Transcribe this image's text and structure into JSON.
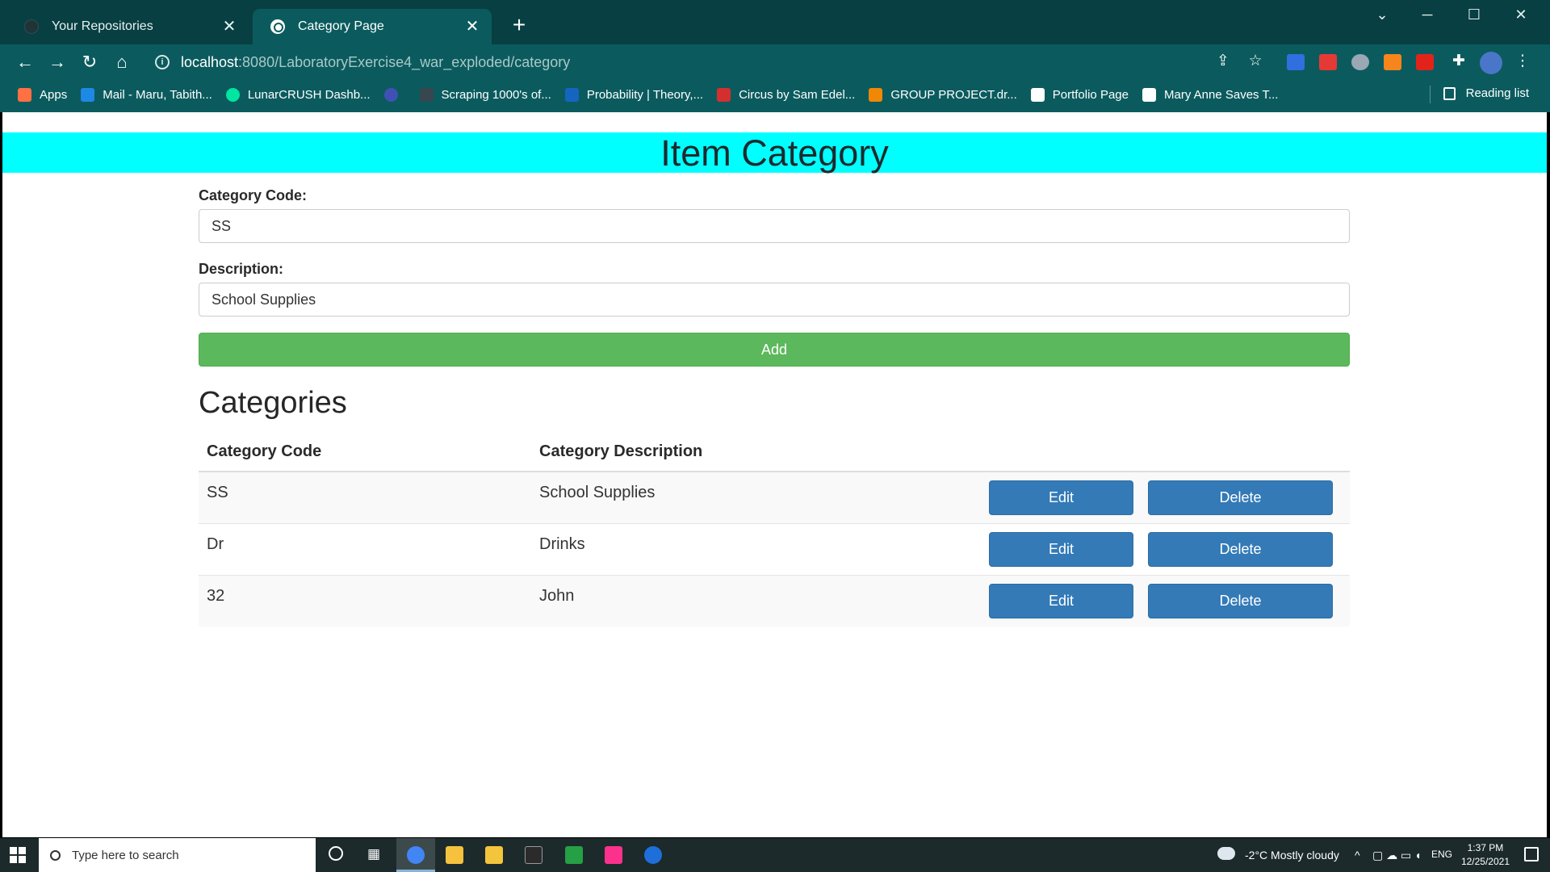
{
  "browser": {
    "tabs": [
      {
        "title": "Your Repositories",
        "active": false
      },
      {
        "title": "Category Page",
        "active": true
      }
    ],
    "url_host": "localhost",
    "url_path": ":8080/LaboratoryExercise4_war_exploded/category",
    "bookmarks": [
      {
        "label": "Apps",
        "icon": "apps-grid-icon",
        "color": "#ff7043"
      },
      {
        "label": "Mail - Maru, Tabith...",
        "icon": "outlook-icon",
        "color": "#1e88e5"
      },
      {
        "label": "LunarCRUSH Dashb...",
        "icon": "lunarcrush-icon",
        "color": "#00e5a0"
      },
      {
        "label": "",
        "icon": "c-circle-icon",
        "color": "#3f51b5"
      },
      {
        "label": "Scraping 1000's of...",
        "icon": "tds-icon",
        "color": "#37474f"
      },
      {
        "label": "Probability | Theory,...",
        "icon": "shield-icon",
        "color": "#1565c0"
      },
      {
        "label": "Circus by Sam Edel...",
        "icon": "flag-icon",
        "color": "#d32f2f"
      },
      {
        "label": "GROUP PROJECT.dr...",
        "icon": "drawio-icon",
        "color": "#f08705"
      },
      {
        "label": "Portfolio Page",
        "icon": "portfolio-icon",
        "color": "#ffffff"
      },
      {
        "label": "Mary Anne Saves T...",
        "icon": "v-icon",
        "color": "#ffffff"
      }
    ],
    "reading_list": "Reading list"
  },
  "page": {
    "banner_title": "Item Category",
    "banner_color": "#00ffff",
    "form": {
      "code_label": "Category Code:",
      "code_value": "SS",
      "description_label": "Description:",
      "description_value": "School Supplies",
      "add_label": "Add"
    },
    "section_title": "Categories",
    "table": {
      "headers": [
        "Category Code",
        "Category Description"
      ],
      "rows": [
        {
          "code": "SS",
          "description": "School Supplies",
          "edit": "Edit",
          "delete": "Delete"
        },
        {
          "code": "Dr",
          "description": "Drinks",
          "edit": "Edit",
          "delete": "Delete"
        },
        {
          "code": "32",
          "description": "John",
          "edit": "Edit",
          "delete": "Delete"
        }
      ]
    },
    "accent_green": "#5cb85c",
    "accent_blue": "#337ab7"
  },
  "taskbar": {
    "search_placeholder": "Type here to search",
    "weather": "-2°C  Mostly cloudy",
    "language": "ENG",
    "time": "1:37 PM",
    "date": "12/25/2021"
  }
}
